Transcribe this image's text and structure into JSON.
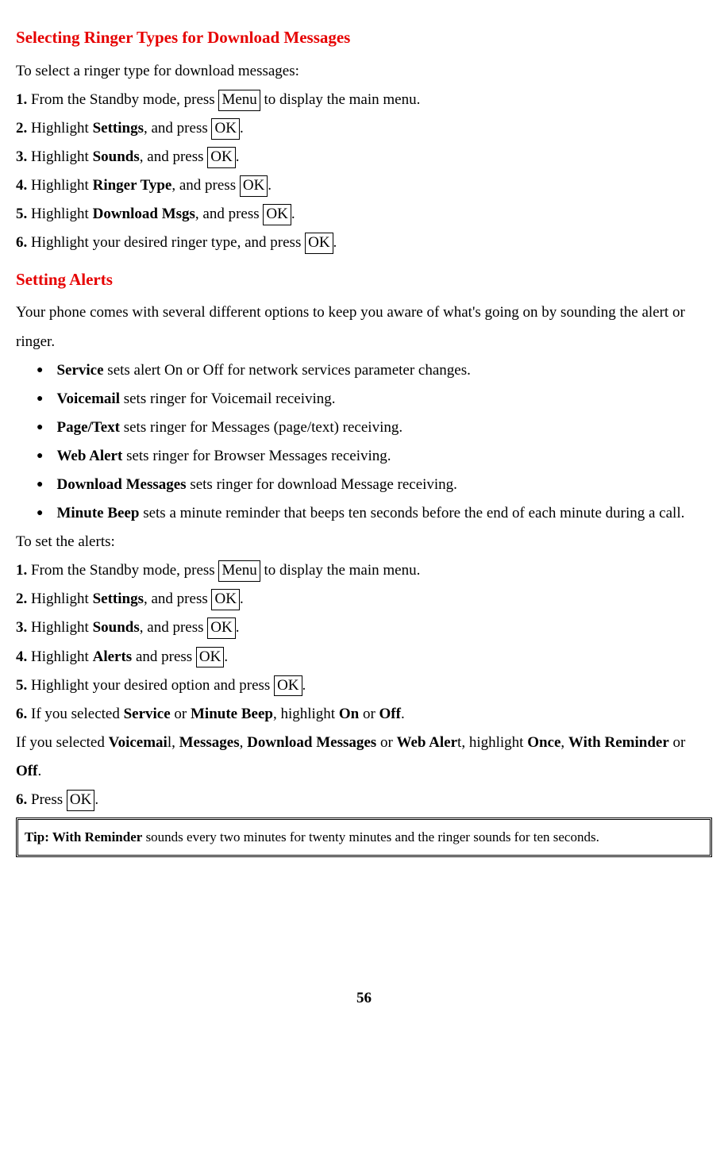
{
  "section1": {
    "heading": "Selecting Ringer Types for Download Messages",
    "intro": "To select a ringer type for download messages:",
    "steps": {
      "s1a": "From the Standby mode, press ",
      "s1b": " to display the main menu.",
      "s2a": "Highlight ",
      "s2b": "Settings",
      "s2c": ", and press ",
      "s3a": "Highlight ",
      "s3b": "Sounds",
      "s3c": ", and press ",
      "s4a": "Highlight ",
      "s4b": "Ringer Type",
      "s4c": ", and press ",
      "s5a": "Highlight ",
      "s5b": "Download Msgs",
      "s5c": ", and press ",
      "s6a": "Highlight your desired ringer type, and press "
    }
  },
  "section2": {
    "heading": "Setting Alerts",
    "intro": "Your phone comes with several different options to keep you aware of what's going on by sounding the alert or ringer.",
    "bullets": {
      "b1t": "Service",
      "b1d": " sets alert On or Off for network services parameter changes.",
      "b2t": "Voicemail",
      "b2d": " sets ringer for Voicemail receiving.",
      "b3t": "Page/Text",
      "b3d": " sets ringer for Messages (page/text) receiving.",
      "b4t": "Web Alert",
      "b4d": " sets ringer for Browser Messages receiving.",
      "b5t": "Download Messages",
      "b5d": " sets ringer for download Message receiving.",
      "b6t": "Minute Beep",
      "b6d": " sets a minute reminder that beeps ten seconds before the end of each minute during a call."
    },
    "intro2": "To set the alerts:",
    "steps": {
      "s1a": "From the Standby mode, press ",
      "s1b": " to display the main menu.",
      "s2a": "Highlight ",
      "s2b": "Settings",
      "s2c": ", and press ",
      "s3a": "Highlight ",
      "s3b": "Sounds",
      "s3c": ", and press ",
      "s4a": "Highlight ",
      "s4b": "Alerts",
      "s4c": " and press ",
      "s5a": "Highlight your desired option and press ",
      "s6a": "If you selected ",
      "s6b": "Service",
      "s6c": " or ",
      "s6d": "Minute Beep",
      "s6e": ", highlight ",
      "s6f": "On",
      "s6g": " or ",
      "s6h": "Off",
      "cond_a": "If you selected ",
      "cond_b": "Voicemai",
      "cond_c": "l, ",
      "cond_d": "Messages",
      "cond_e": ", ",
      "cond_f": "Download Messages",
      "cond_g": " or ",
      "cond_h": "Web Aler",
      "cond_i": "t, highlight ",
      "cond_j": "Once",
      "cond_k": ", ",
      "cond_l": "With Reminder",
      "cond_m": " or ",
      "cond_n": "Off",
      "s7a": "Press "
    },
    "tip": {
      "label": "Tip: With Reminder",
      "text": " sounds every two minutes for twenty minutes and the ringer sounds for ten seconds."
    }
  },
  "keys": {
    "menu": "Menu",
    "ok": "OK"
  },
  "nums": {
    "n1": "1.",
    "n2": "2.",
    "n3": "3.",
    "n4": "4.",
    "n5": "5.",
    "n6": "6."
  },
  "period": ".",
  "pageNum": "56"
}
